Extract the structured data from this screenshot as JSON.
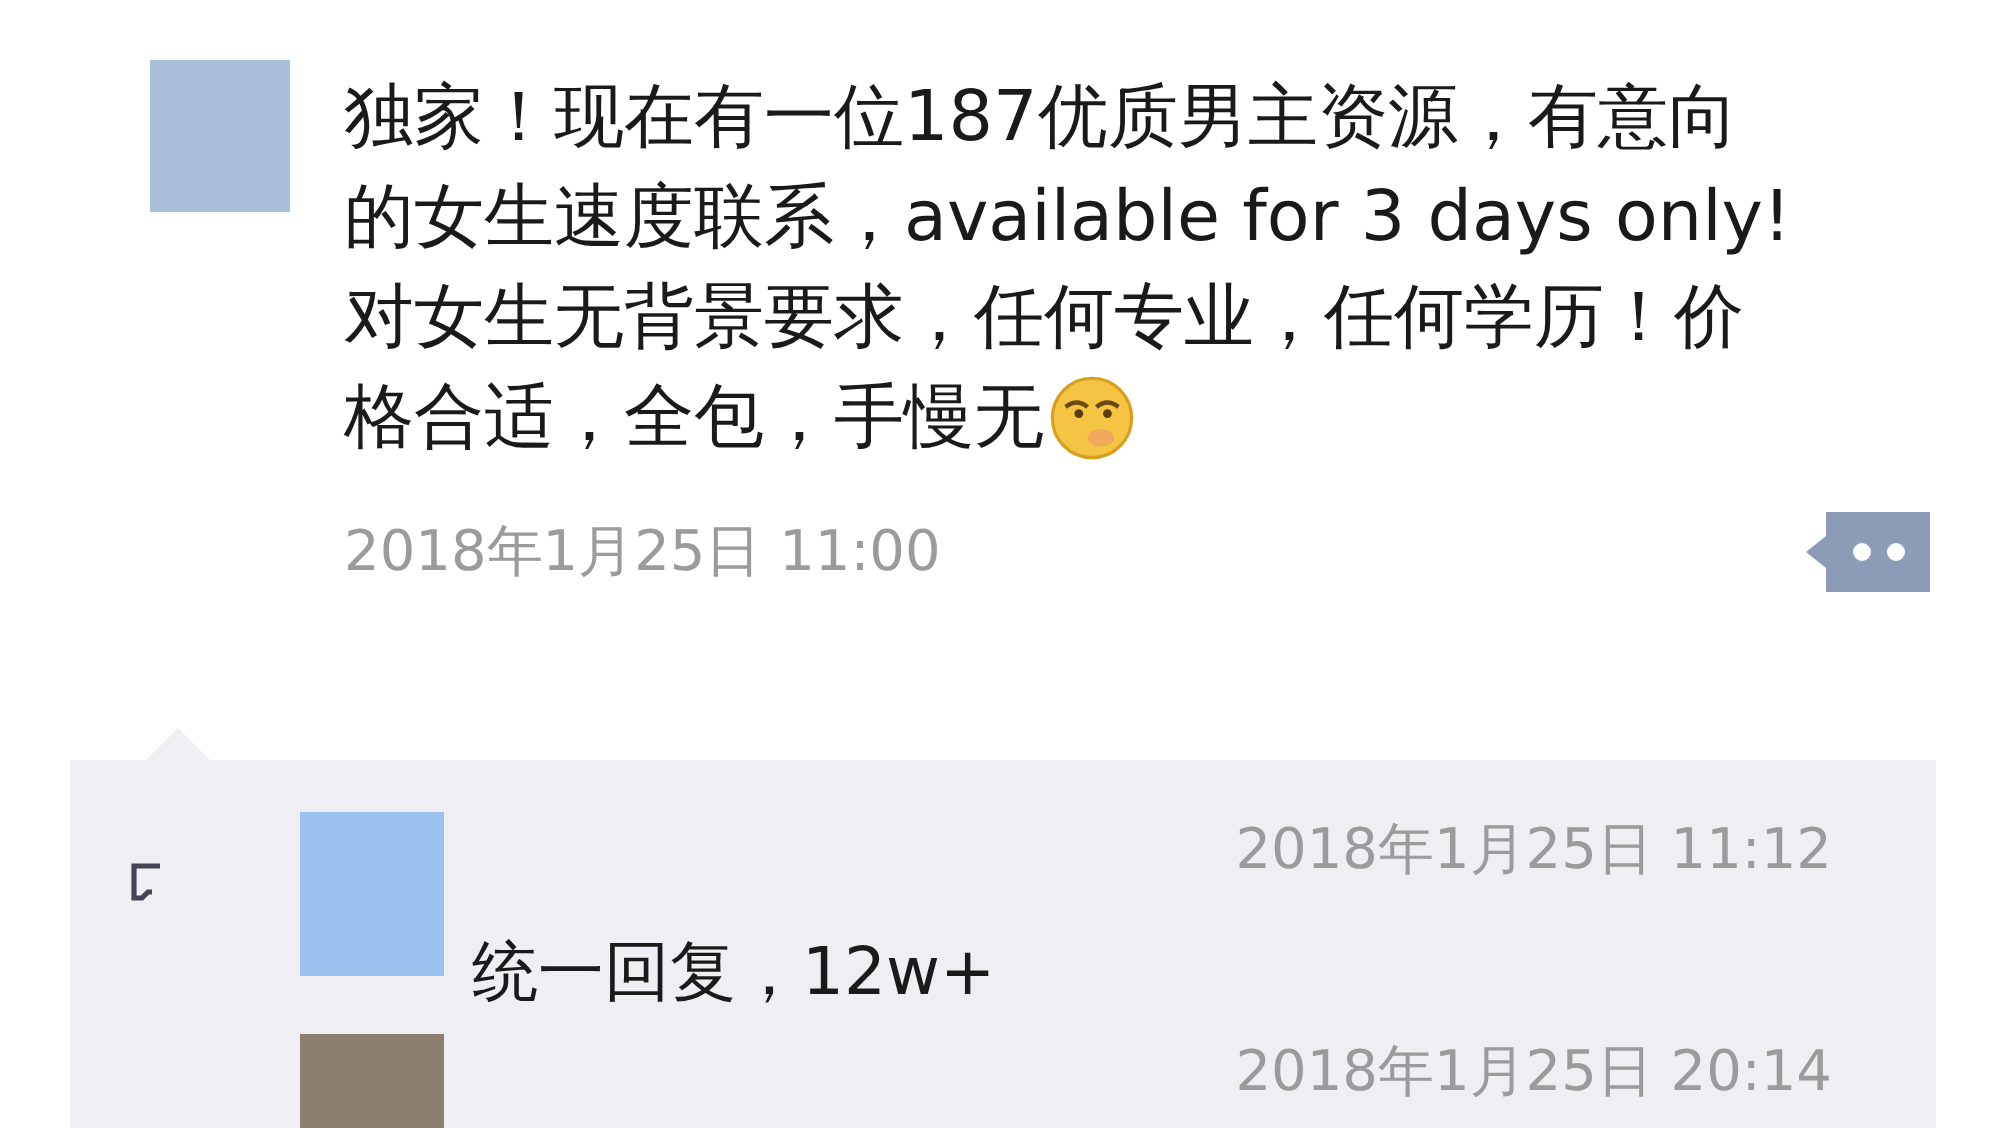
{
  "post": {
    "text_lines": [
      "独家！现在有一位187优质男主资源，有意向",
      "的女生速度联系，available for 3 days only!",
      "对女生无背景要求，任何专业，任何学历！价",
      "格合适，全包，手慢无"
    ],
    "time": "2018年1月25日 11:00"
  },
  "comments": [
    {
      "time": "2018年1月25日 11:12",
      "text": "统一回复，12w+"
    },
    {
      "time": "2018年1月25日 20:14"
    }
  ]
}
